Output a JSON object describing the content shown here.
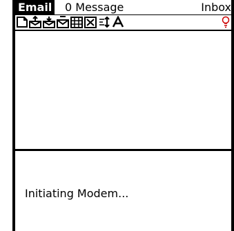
{
  "header": {
    "app_title": "Email",
    "message_count": "0 Message",
    "folder": "Inbox"
  },
  "toolbar": {
    "icons": [
      "new-message-icon",
      "send-icon",
      "receive-icon",
      "send-receive-icon",
      "address-book-icon",
      "delete-icon",
      "sort-icon",
      "font-icon",
      "lightbulb-icon"
    ]
  },
  "status": {
    "text": "Initiating Modem..."
  },
  "colors": {
    "foreground": "#000000",
    "background": "#ffffff",
    "bulb": "#cc0000"
  }
}
